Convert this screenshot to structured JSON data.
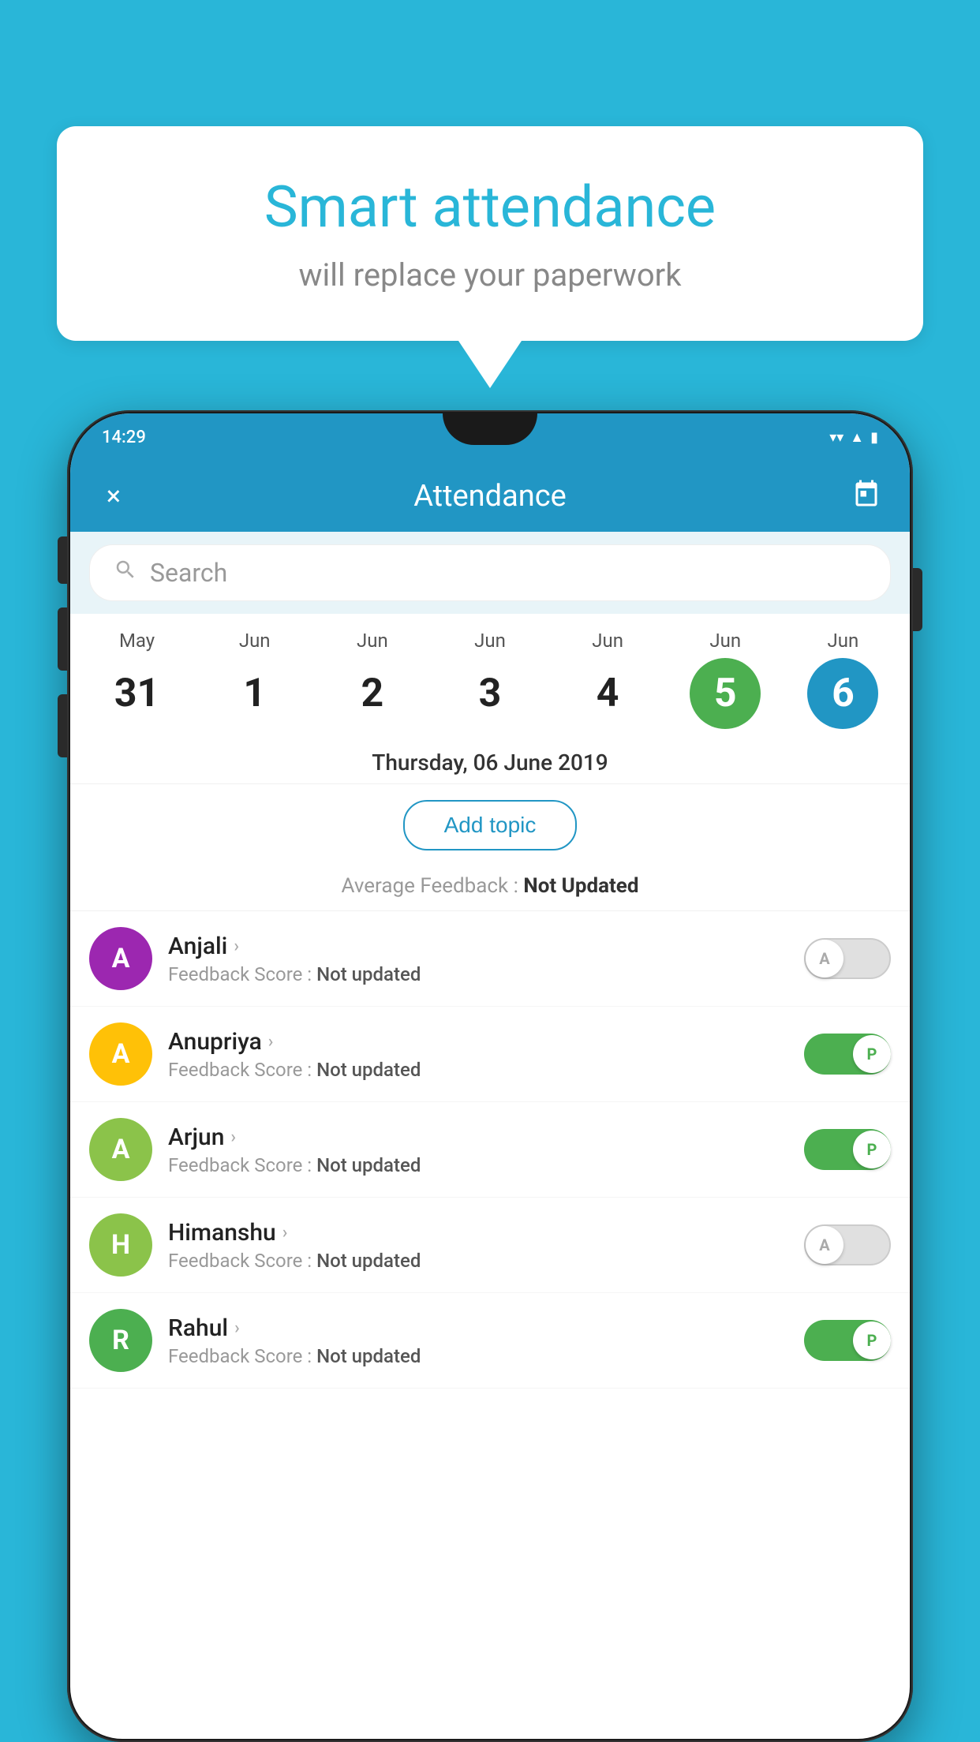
{
  "background_color": "#29b6d8",
  "speech_bubble": {
    "title": "Smart attendance",
    "subtitle": "will replace your paperwork"
  },
  "status_bar": {
    "time": "14:29",
    "icons": [
      "wifi",
      "signal",
      "battery"
    ]
  },
  "app_bar": {
    "title": "Attendance",
    "close_label": "×",
    "calendar_icon": "📅"
  },
  "search": {
    "placeholder": "Search"
  },
  "calendar": {
    "days": [
      {
        "month": "May",
        "date": "31",
        "state": "normal"
      },
      {
        "month": "Jun",
        "date": "1",
        "state": "normal"
      },
      {
        "month": "Jun",
        "date": "2",
        "state": "normal"
      },
      {
        "month": "Jun",
        "date": "3",
        "state": "normal"
      },
      {
        "month": "Jun",
        "date": "4",
        "state": "normal"
      },
      {
        "month": "Jun",
        "date": "5",
        "state": "today"
      },
      {
        "month": "Jun",
        "date": "6",
        "state": "selected"
      }
    ]
  },
  "selected_date": "Thursday, 06 June 2019",
  "add_topic_label": "Add topic",
  "average_feedback": {
    "label": "Average Feedback : ",
    "value": "Not Updated"
  },
  "students": [
    {
      "name": "Anjali",
      "avatar_letter": "A",
      "avatar_color": "#9c27b0",
      "feedback_label": "Feedback Score : ",
      "feedback_value": "Not updated",
      "attendance": "absent",
      "toggle_letter": "A"
    },
    {
      "name": "Anupriya",
      "avatar_letter": "A",
      "avatar_color": "#ffc107",
      "feedback_label": "Feedback Score : ",
      "feedback_value": "Not updated",
      "attendance": "present",
      "toggle_letter": "P"
    },
    {
      "name": "Arjun",
      "avatar_letter": "A",
      "avatar_color": "#8bc34a",
      "feedback_label": "Feedback Score : ",
      "feedback_value": "Not updated",
      "attendance": "present",
      "toggle_letter": "P"
    },
    {
      "name": "Himanshu",
      "avatar_letter": "H",
      "avatar_color": "#8bc34a",
      "feedback_label": "Feedback Score : ",
      "feedback_value": "Not updated",
      "attendance": "absent",
      "toggle_letter": "A"
    },
    {
      "name": "Rahul",
      "avatar_letter": "R",
      "avatar_color": "#4caf50",
      "feedback_label": "Feedback Score : ",
      "feedback_value": "Not updated",
      "attendance": "present",
      "toggle_letter": "P"
    }
  ]
}
